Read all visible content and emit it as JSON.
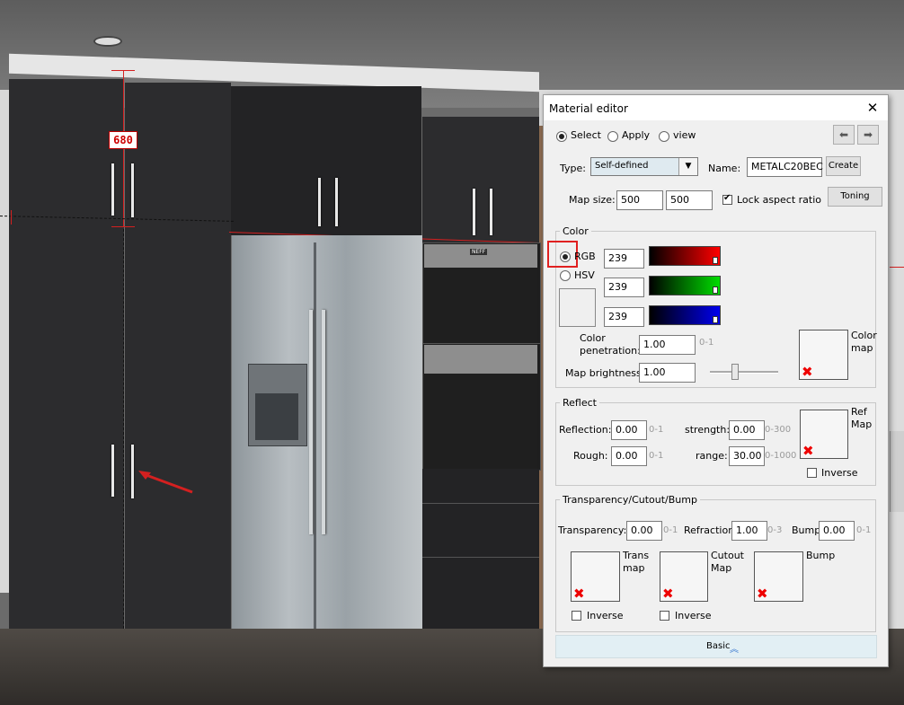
{
  "scene": {
    "dimension_label": "680",
    "oven_brand": "NEFF"
  },
  "dialog": {
    "title": "Material editor",
    "close_glyph": "✕",
    "mode_options": [
      "Select",
      "Apply",
      "view"
    ],
    "mode_selected": "Select",
    "undo_glyph": "⬅",
    "redo_glyph": "➡",
    "type_label": "Type:",
    "type_value": "Self-defined",
    "name_label": "Name:",
    "name_value": "METALC20BEC",
    "create_label": "Create",
    "map_size_label": "Map size:",
    "map_w": "500",
    "map_h": "500",
    "lock_aspect_label": "Lock aspect ratio",
    "lock_aspect_checked": true,
    "toning_label": "Toning",
    "color": {
      "group_title": "Color",
      "rgb_label": "RGB",
      "hsv_label": "HSV",
      "selected": "RGB",
      "r": "239",
      "g": "239",
      "b": "239",
      "swatch": "#efefef",
      "penetration_label": "Color penetration:",
      "penetration_label_1": "Color",
      "penetration_label_2": "penetration:",
      "penetration": "1.00",
      "penetration_hint": "0-1",
      "map_brightness_label": "Map brightness:",
      "map_brightness": "1.00",
      "color_map_label_1": "Color",
      "color_map_label_2": "map",
      "slider_level": 0.4
    },
    "reflect": {
      "group_title": "Reflect",
      "reflection_label": "Reflection:",
      "reflection": "0.00",
      "reflection_hint": "0-1",
      "strength_label": "strength:",
      "strength": "0.00",
      "strength_hint": "0-300",
      "rough_label": "Rough:",
      "rough": "0.00",
      "rough_hint": "0-1",
      "range_label": "range:",
      "range": "30.00",
      "range_hint": "0-1000",
      "ref_map_label_1": "Ref",
      "ref_map_label_2": "Map",
      "inverse_label": "Inverse"
    },
    "transparency": {
      "group_title": "Transparency/Cutout/Bump",
      "transparency_label": "Transparency:",
      "transparency": "0.00",
      "transparency_hint": "0-1",
      "refraction_label": "Refraction",
      "refraction": "1.00",
      "refraction_hint": "0-3",
      "bump_label": "Bump",
      "bump": "0.00",
      "bump_hint": "0-1",
      "trans_map_label_1": "Trans",
      "trans_map_label_2": "map",
      "cutout_map_label_1": "Cutout",
      "cutout_map_label_2": "Map",
      "bump_map_label": "Bump",
      "inverse_label": "Inverse"
    },
    "footer_label": "Basic",
    "footer_icon": "︽"
  },
  "colors": {
    "accent_red": "#e00000",
    "highlight_box": "#e02020"
  }
}
